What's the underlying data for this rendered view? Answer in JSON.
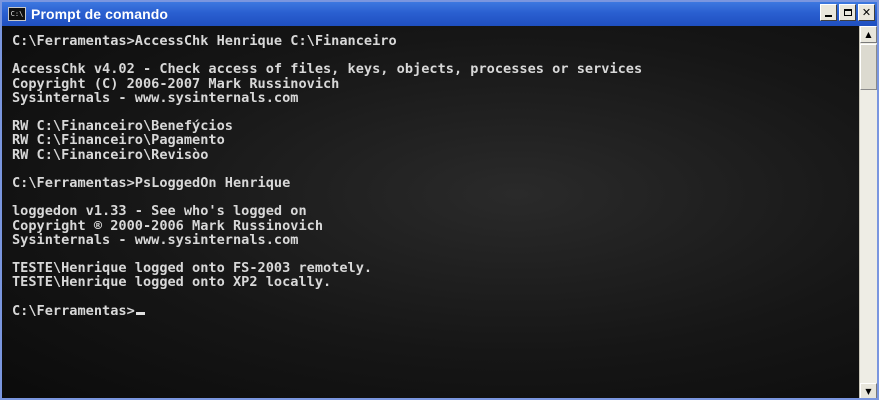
{
  "window": {
    "title": "Prompt de comando",
    "icon": "console-icon",
    "icon_text": "C:\\"
  },
  "console": {
    "lines": [
      "C:\\Ferramentas>AccessChk Henrique C:\\Financeiro",
      "",
      "AccessChk v4.02 - Check access of files, keys, objects, processes or services",
      "Copyright (C) 2006-2007 Mark Russinovich",
      "Sysinternals - www.sysinternals.com",
      "",
      "RW C:\\Financeiro\\Benefýcios",
      "RW C:\\Financeiro\\Pagamento",
      "RW C:\\Financeiro\\Revisòo",
      "",
      "C:\\Ferramentas>PsLoggedOn Henrique",
      "",
      "loggedon v1.33 - See who's logged on",
      "Copyright ® 2000-2006 Mark Russinovich",
      "Sysinternals - www.sysinternals.com",
      "",
      "TESTE\\Henrique logged onto FS-2003 remotely.",
      "TESTE\\Henrique logged onto XP2 locally.",
      "",
      "C:\\Ferramentas>"
    ]
  },
  "controls": {
    "minimize": "minimize-icon",
    "maximize": "maximize-icon",
    "close": "close-icon",
    "close_glyph": "✕",
    "scroll_up_glyph": "▲",
    "scroll_down_glyph": "▼"
  }
}
